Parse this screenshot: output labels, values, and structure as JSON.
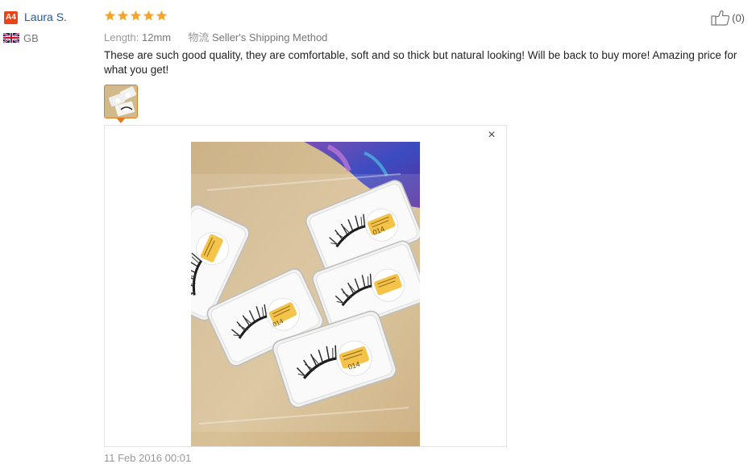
{
  "reviewer": {
    "badge": "A4",
    "name": "Laura S.",
    "country": "GB"
  },
  "rating": {
    "stars": 5,
    "max": 5,
    "color": "#f5a623"
  },
  "attributes": [
    {
      "label": "Length:",
      "value": "12mm"
    },
    {
      "label": "物流",
      "value": "Seller's Shipping Method"
    }
  ],
  "review": {
    "text": "These are such good quality, they are comfortable, soft and so thick but natural looking! Will be back to buy more! Amazing price for what you get!",
    "date": "11 Feb 2016 00:01"
  },
  "helpful": {
    "count": "(0)"
  },
  "viewer": {
    "close_label": "×"
  },
  "photo": {
    "tray_labels": [
      "014",
      "014",
      "014"
    ]
  },
  "colors": {
    "accent": "#e07b22",
    "link": "#1a5ca8",
    "badge": "#e8441b"
  }
}
